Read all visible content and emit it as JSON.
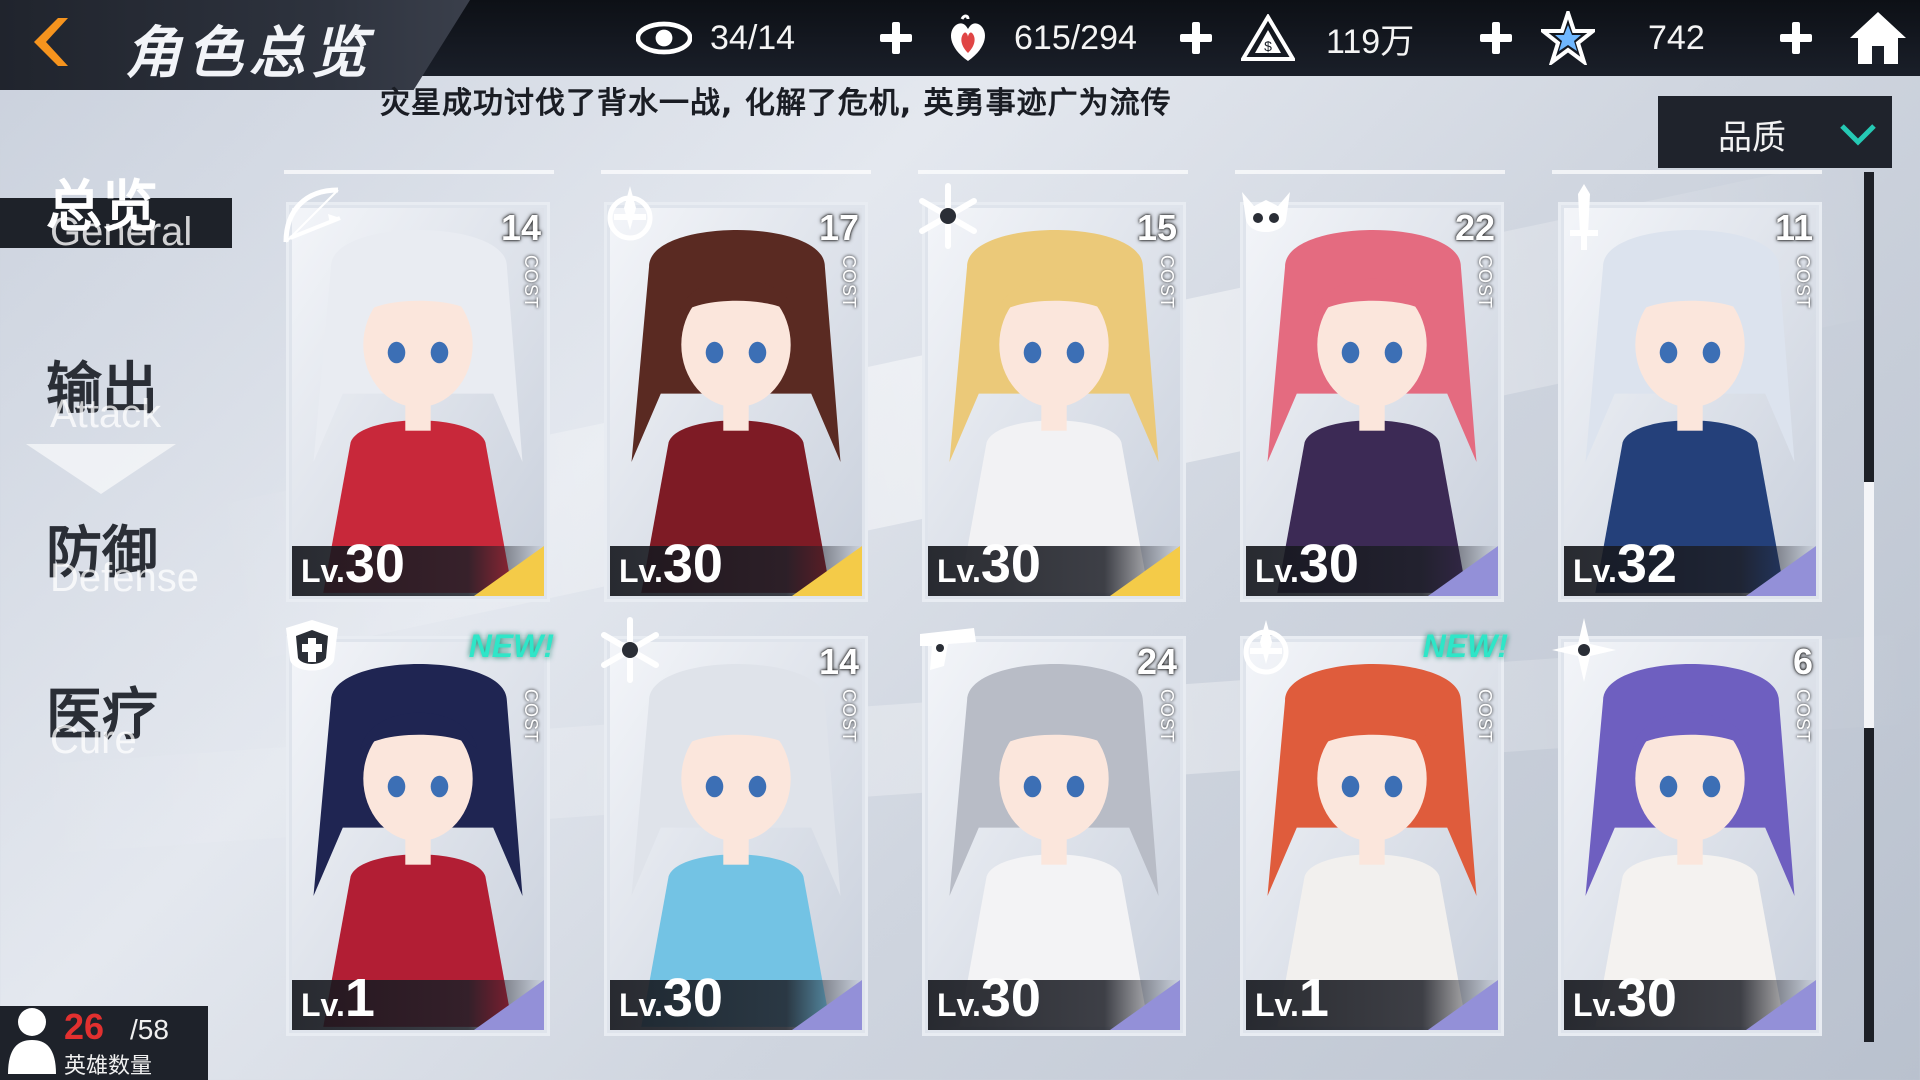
{
  "header": {
    "title": "角色总览",
    "resources": [
      {
        "name": "stamina",
        "icon": "eye-icon",
        "value": "34/14"
      },
      {
        "name": "hearts",
        "icon": "heart-flame-icon",
        "value": "615/294"
      },
      {
        "name": "gold",
        "icon": "triangle-coin-icon",
        "value": "119万"
      },
      {
        "name": "crystal",
        "icon": "star-crystal-icon",
        "value": "742"
      }
    ]
  },
  "notice": "灾星成功讨伐了背水一战, 化解了危机, 英勇事迹广为流传",
  "sort": {
    "label": "品质"
  },
  "tabs": [
    {
      "cn": "总览",
      "en": "General",
      "active": true
    },
    {
      "cn": "输出",
      "en": "Attack",
      "active": false
    },
    {
      "cn": "防御",
      "en": "Defense",
      "active": false
    },
    {
      "cn": "医疗",
      "en": "Cure",
      "active": false
    }
  ],
  "cost_label": "COST",
  "level_prefix": "Lv.",
  "new_label": "NEW!",
  "cards": [
    {
      "cost": "14",
      "level": "30",
      "class_icon": "bow-icon",
      "rarity": "gold",
      "hair": "#e9ecf2",
      "outfit": "#c8283a",
      "new": false
    },
    {
      "cost": "17",
      "level": "30",
      "class_icon": "guardian-emblem-icon",
      "rarity": "gold",
      "hair": "#5a2a22",
      "outfit": "#7e1b25",
      "new": false
    },
    {
      "cost": "15",
      "level": "30",
      "class_icon": "snowflake-icon",
      "rarity": "gold",
      "hair": "#ebc979",
      "outfit": "#f2f2f4",
      "new": false
    },
    {
      "cost": "22",
      "level": "30",
      "class_icon": "demon-skull-icon",
      "rarity": "purple",
      "hair": "#e46b80",
      "outfit": "#3c2a55",
      "new": false
    },
    {
      "cost": "11",
      "level": "32",
      "class_icon": "sword-icon",
      "rarity": "purple",
      "hair": "#dce3ee",
      "outfit": "#24407a",
      "new": false
    },
    {
      "cost": "",
      "level": "1",
      "class_icon": "shield-cross-icon",
      "rarity": "purple",
      "hair": "#1f2552",
      "outfit": "#b21e34",
      "new": true
    },
    {
      "cost": "14",
      "level": "30",
      "class_icon": "snowflake-icon",
      "rarity": "purple",
      "hair": "#dfe3ea",
      "outfit": "#73c3e4",
      "new": false
    },
    {
      "cost": "24",
      "level": "30",
      "class_icon": "gun-icon",
      "rarity": "purple",
      "hair": "#b8bcc6",
      "outfit": "#f3f3f5",
      "new": false
    },
    {
      "cost": "",
      "level": "1",
      "class_icon": "guardian-emblem-icon",
      "rarity": "purple",
      "hair": "#df5c3c",
      "outfit": "#f2f0ee",
      "new": true
    },
    {
      "cost": "6",
      "level": "30",
      "class_icon": "shuriken-icon",
      "rarity": "purple",
      "hair": "#6e5fc0",
      "outfit": "#f4f2f0",
      "new": false
    }
  ],
  "colors": {
    "gold_rarity": "#f4cb48",
    "purple_rarity": "#9390d8",
    "accent_back": "#f6941e",
    "new_tag": "#2ee6c8"
  },
  "hero_count": {
    "current": "26",
    "max": "/58",
    "label": "英雄数量"
  }
}
